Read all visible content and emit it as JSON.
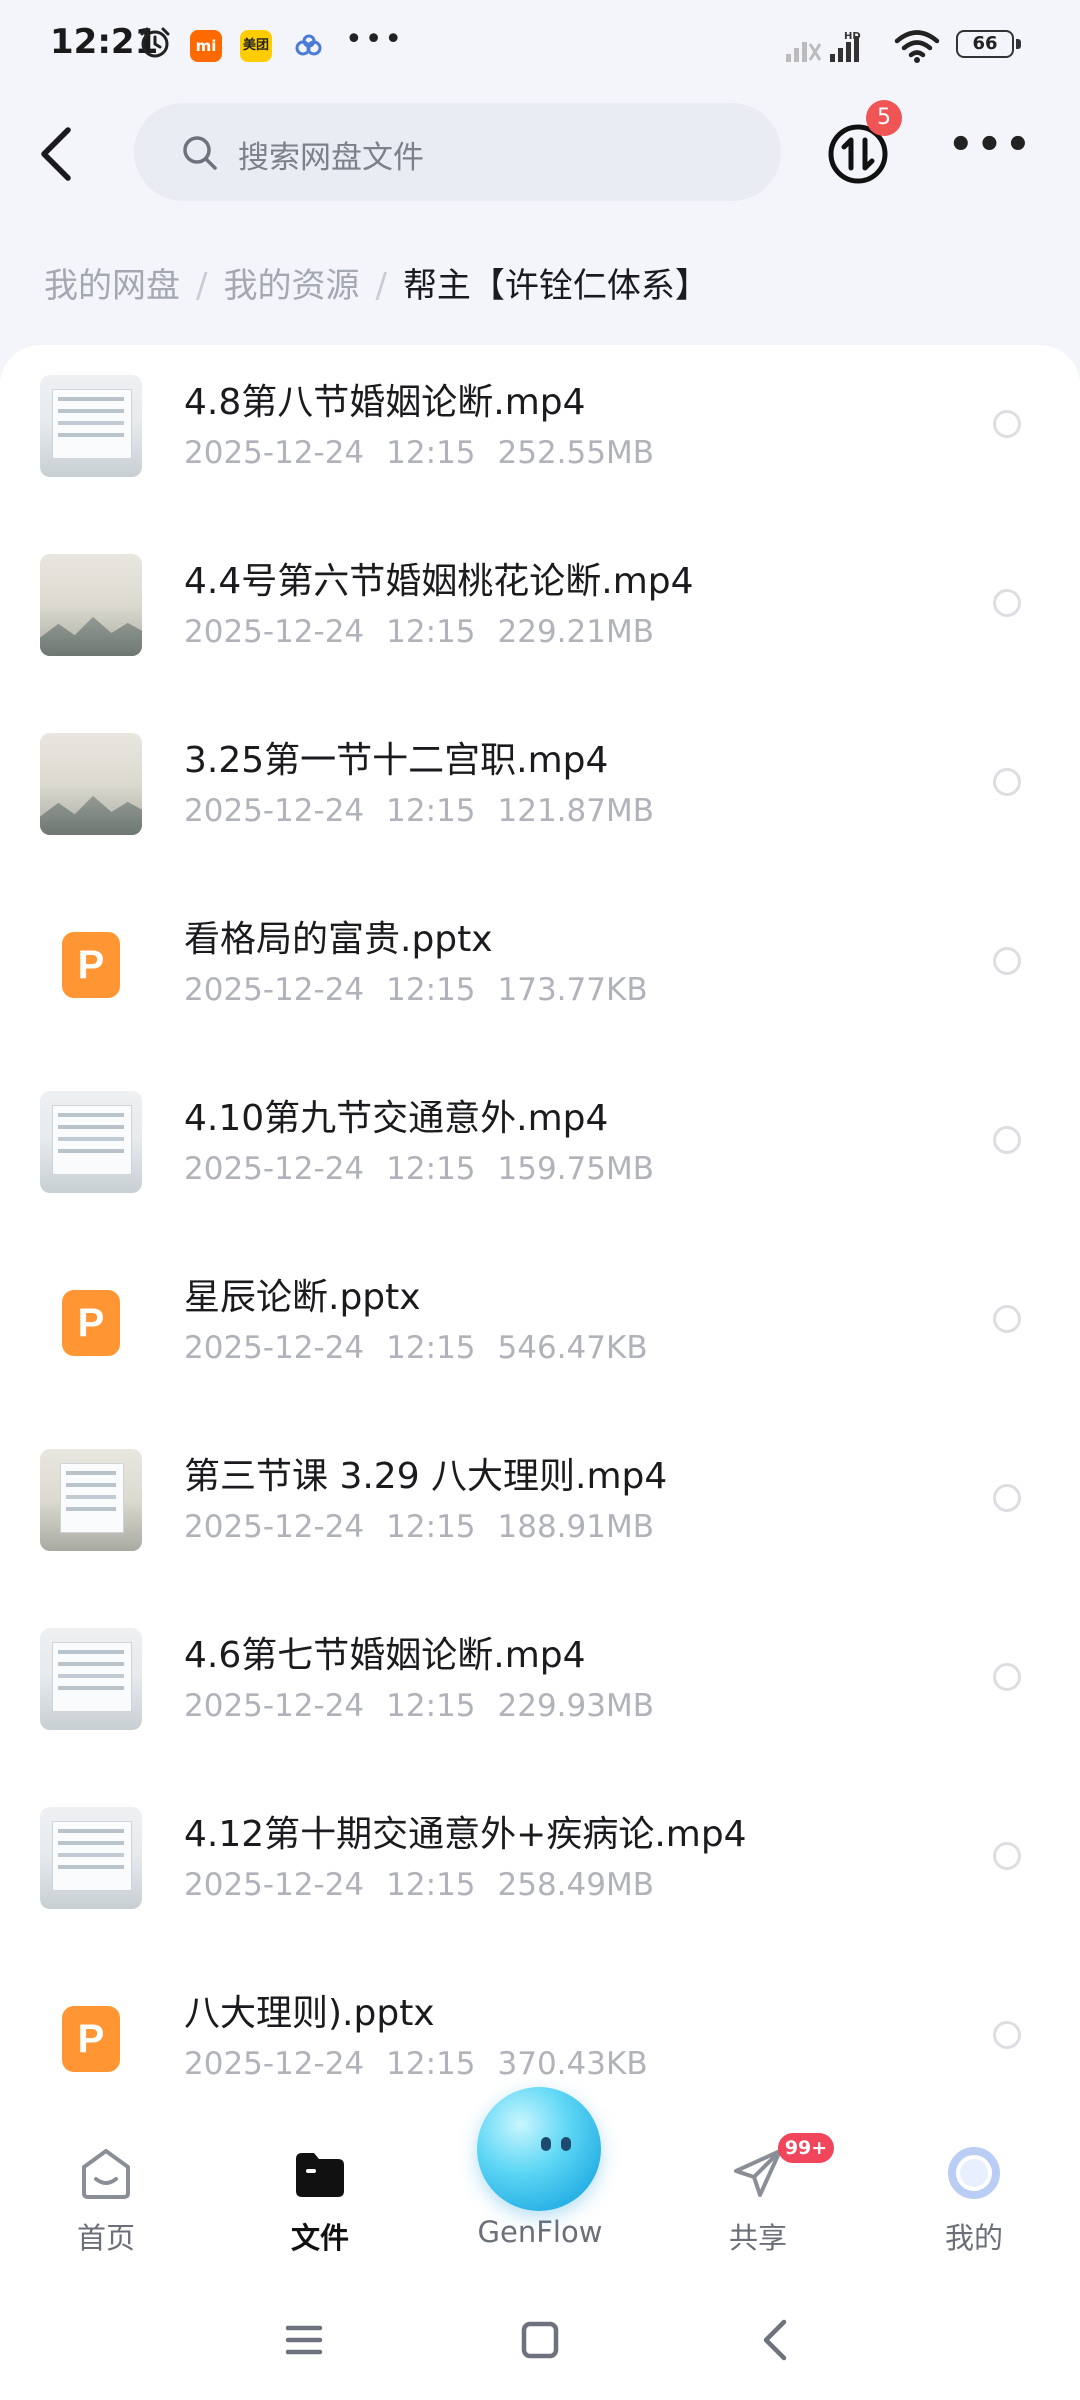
{
  "status_bar": {
    "time": "12:21",
    "app_icons": [
      {
        "name": "xiaomi-app-icon",
        "text": "mi"
      },
      {
        "name": "meituan-app-icon",
        "text": "美团"
      }
    ],
    "more_notifications": "•••",
    "network_label": "HD",
    "battery_level": "66"
  },
  "header": {
    "back_icon": "back-arrow-icon",
    "search_placeholder": "搜索网盘文件",
    "transfer_badge": "5",
    "more_icon": "more-dots-icon"
  },
  "breadcrumb": [
    {
      "label": "我的网盘"
    },
    {
      "label": "我的资源"
    },
    {
      "label": "帮主【许铨仁体系】"
    }
  ],
  "files": [
    {
      "name": "4.8第八节婚姻论断.mp4",
      "date": "2025-12-24",
      "time": "12:15",
      "size": "252.55MB",
      "type": "video"
    },
    {
      "name": "4.4号第六节婚姻桃花论断.mp4",
      "date": "2025-12-24",
      "time": "12:15",
      "size": "229.21MB",
      "type": "video"
    },
    {
      "name": "3.25第一节十二宫职.mp4",
      "date": "2025-12-24",
      "time": "12:15",
      "size": "121.87MB",
      "type": "video"
    },
    {
      "name": "看格局的富贵.pptx",
      "date": "2025-12-24",
      "time": "12:15",
      "size": "173.77KB",
      "type": "pptx"
    },
    {
      "name": "4.10第九节交通意外.mp4",
      "date": "2025-12-24",
      "time": "12:15",
      "size": "159.75MB",
      "type": "video"
    },
    {
      "name": "星辰论断.pptx",
      "date": "2025-12-24",
      "time": "12:15",
      "size": "546.47KB",
      "type": "pptx"
    },
    {
      "name": "第三节课 3.29 八大理则.mp4",
      "date": "2025-12-24",
      "time": "12:15",
      "size": "188.91MB",
      "type": "video"
    },
    {
      "name": "4.6第七节婚姻论断.mp4",
      "date": "2025-12-24",
      "time": "12:15",
      "size": "229.93MB",
      "type": "video"
    },
    {
      "name": "4.12第十期交通意外+疾病论.mp4",
      "date": "2025-12-24",
      "time": "12:15",
      "size": "258.49MB",
      "type": "video"
    },
    {
      "name": "八大理则).pptx",
      "date": "2025-12-24",
      "time": "12:15",
      "size": "370.43KB",
      "type": "pptx"
    }
  ],
  "ppt_letter": "P",
  "bottom_nav": [
    {
      "label": "首页",
      "icon": "home-face-icon"
    },
    {
      "label": "文件",
      "icon": "folder-icon",
      "active": true
    },
    {
      "label": "GenFlow",
      "icon": "genflow-ball-icon"
    },
    {
      "label": "共享",
      "icon": "paper-plane-icon",
      "badge": "99+"
    },
    {
      "label": "我的",
      "icon": "profile-ring-icon"
    }
  ],
  "colors": {
    "accent_orange": "#ff9633",
    "badge_red": "#f05454",
    "genflow_blue": "#2bb3e6"
  }
}
